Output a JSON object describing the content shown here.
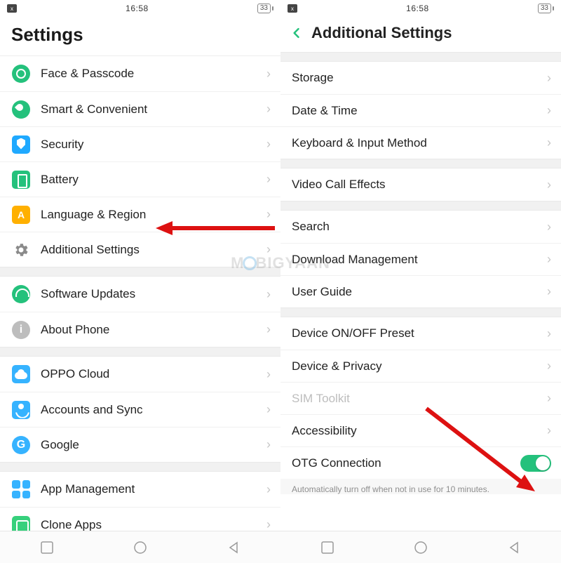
{
  "status": {
    "time": "16:58",
    "battery": "33"
  },
  "left": {
    "title": "Settings",
    "groups": [
      [
        {
          "key": "face",
          "label": "Face & Passcode"
        },
        {
          "key": "smart",
          "label": "Smart & Convenient"
        },
        {
          "key": "security",
          "label": "Security"
        },
        {
          "key": "battery",
          "label": "Battery"
        },
        {
          "key": "lang",
          "label": "Language & Region"
        },
        {
          "key": "addl",
          "label": "Additional Settings"
        }
      ],
      [
        {
          "key": "update",
          "label": "Software Updates"
        },
        {
          "key": "about",
          "label": "About Phone"
        }
      ],
      [
        {
          "key": "cloud",
          "label": "OPPO Cloud"
        },
        {
          "key": "accounts",
          "label": "Accounts and Sync"
        },
        {
          "key": "google",
          "label": "Google"
        }
      ],
      [
        {
          "key": "appmgmt",
          "label": "App Management"
        },
        {
          "key": "clone",
          "label": "Clone Apps"
        }
      ]
    ]
  },
  "right": {
    "title": "Additional Settings",
    "groups": [
      [
        {
          "key": "storage",
          "label": "Storage"
        },
        {
          "key": "datetime",
          "label": "Date & Time"
        },
        {
          "key": "keyboard",
          "label": "Keyboard & Input Method"
        }
      ],
      [
        {
          "key": "video",
          "label": "Video Call Effects"
        }
      ],
      [
        {
          "key": "search",
          "label": "Search"
        },
        {
          "key": "download",
          "label": "Download Management"
        },
        {
          "key": "guide",
          "label": "User Guide"
        }
      ],
      [
        {
          "key": "onoff",
          "label": "Device ON/OFF Preset"
        },
        {
          "key": "privacy",
          "label": "Device & Privacy"
        },
        {
          "key": "sim",
          "label": "SIM Toolkit",
          "disabled": true
        },
        {
          "key": "a11y",
          "label": "Accessibility"
        },
        {
          "key": "otg",
          "label": "OTG Connection",
          "toggle": true,
          "on": true
        }
      ]
    ],
    "otg_caption": "Automatically turn off when not in use for 10 minutes."
  },
  "watermark": "MOBIGYAAN"
}
